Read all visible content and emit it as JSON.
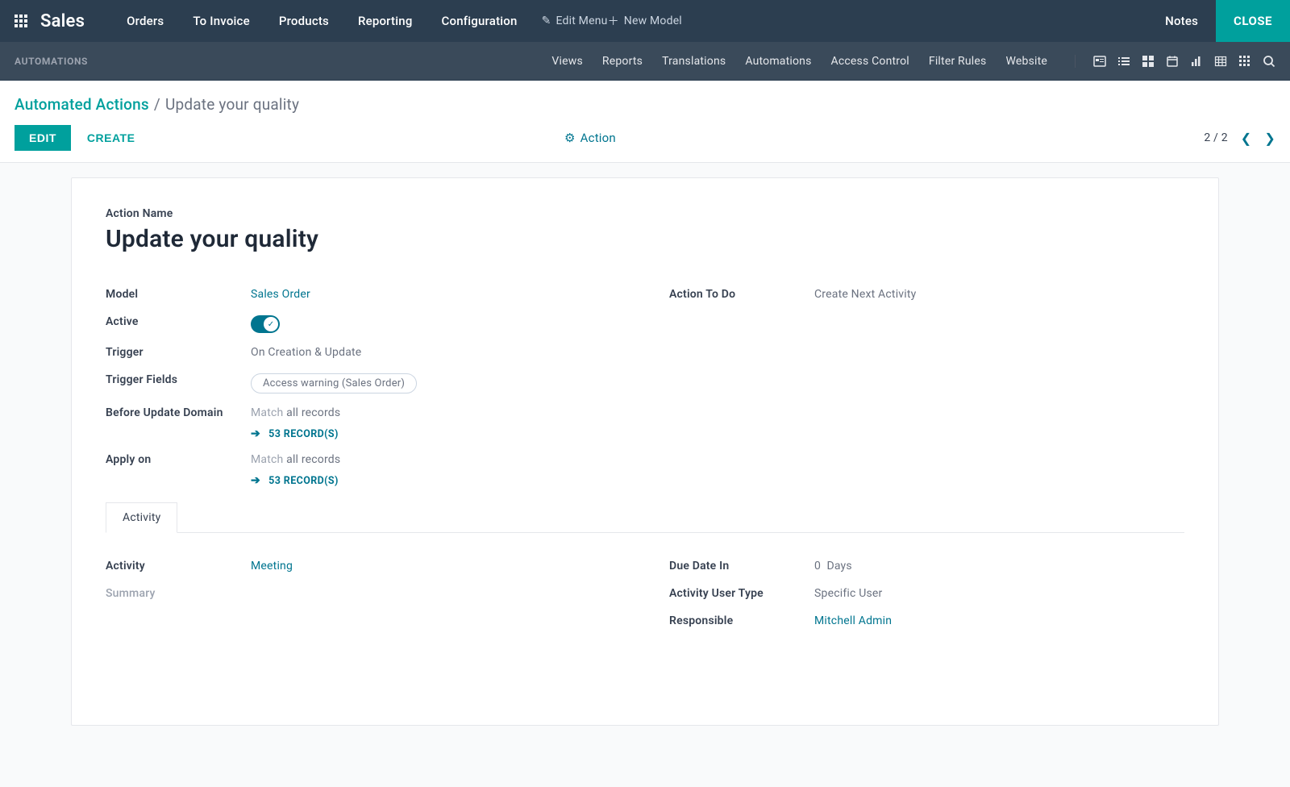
{
  "topbar": {
    "brand": "Sales",
    "nav": [
      "Orders",
      "To Invoice",
      "Products",
      "Reporting",
      "Configuration"
    ],
    "edit_menu": "Edit Menu",
    "new_model": "New Model",
    "notes": "Notes",
    "close": "CLOSE"
  },
  "subbar": {
    "title": "AUTOMATIONS",
    "nav": [
      "Views",
      "Reports",
      "Translations",
      "Automations",
      "Access Control",
      "Filter Rules",
      "Website"
    ]
  },
  "breadcrumb": {
    "root": "Automated Actions",
    "leaf": "Update your quality"
  },
  "actions": {
    "edit": "EDIT",
    "create": "CREATE",
    "action_menu": "Action",
    "pager": "2 / 2"
  },
  "form": {
    "action_name_label": "Action Name",
    "title": "Update your quality",
    "left": {
      "model_label": "Model",
      "model_value": "Sales Order",
      "active_label": "Active",
      "trigger_label": "Trigger",
      "trigger_value": "On Creation & Update",
      "trigger_fields_label": "Trigger Fields",
      "trigger_fields_value": "Access warning (Sales Order)",
      "before_domain_label": "Before Update Domain",
      "match_prefix": "Match",
      "match_suffix": " all records",
      "records_link": "53 RECORD(S)",
      "apply_on_label": "Apply on"
    },
    "right": {
      "action_todo_label": "Action To Do",
      "action_todo_value": "Create Next Activity"
    },
    "tabs": {
      "activity": "Activity"
    },
    "activity_tab": {
      "activity_label": "Activity",
      "activity_value": "Meeting",
      "summary_label": "Summary",
      "due_label": "Due Date In",
      "due_value": "0",
      "due_unit": "Days",
      "user_type_label": "Activity User Type",
      "user_type_value": "Specific User",
      "responsible_label": "Responsible",
      "responsible_value": "Mitchell Admin"
    }
  }
}
